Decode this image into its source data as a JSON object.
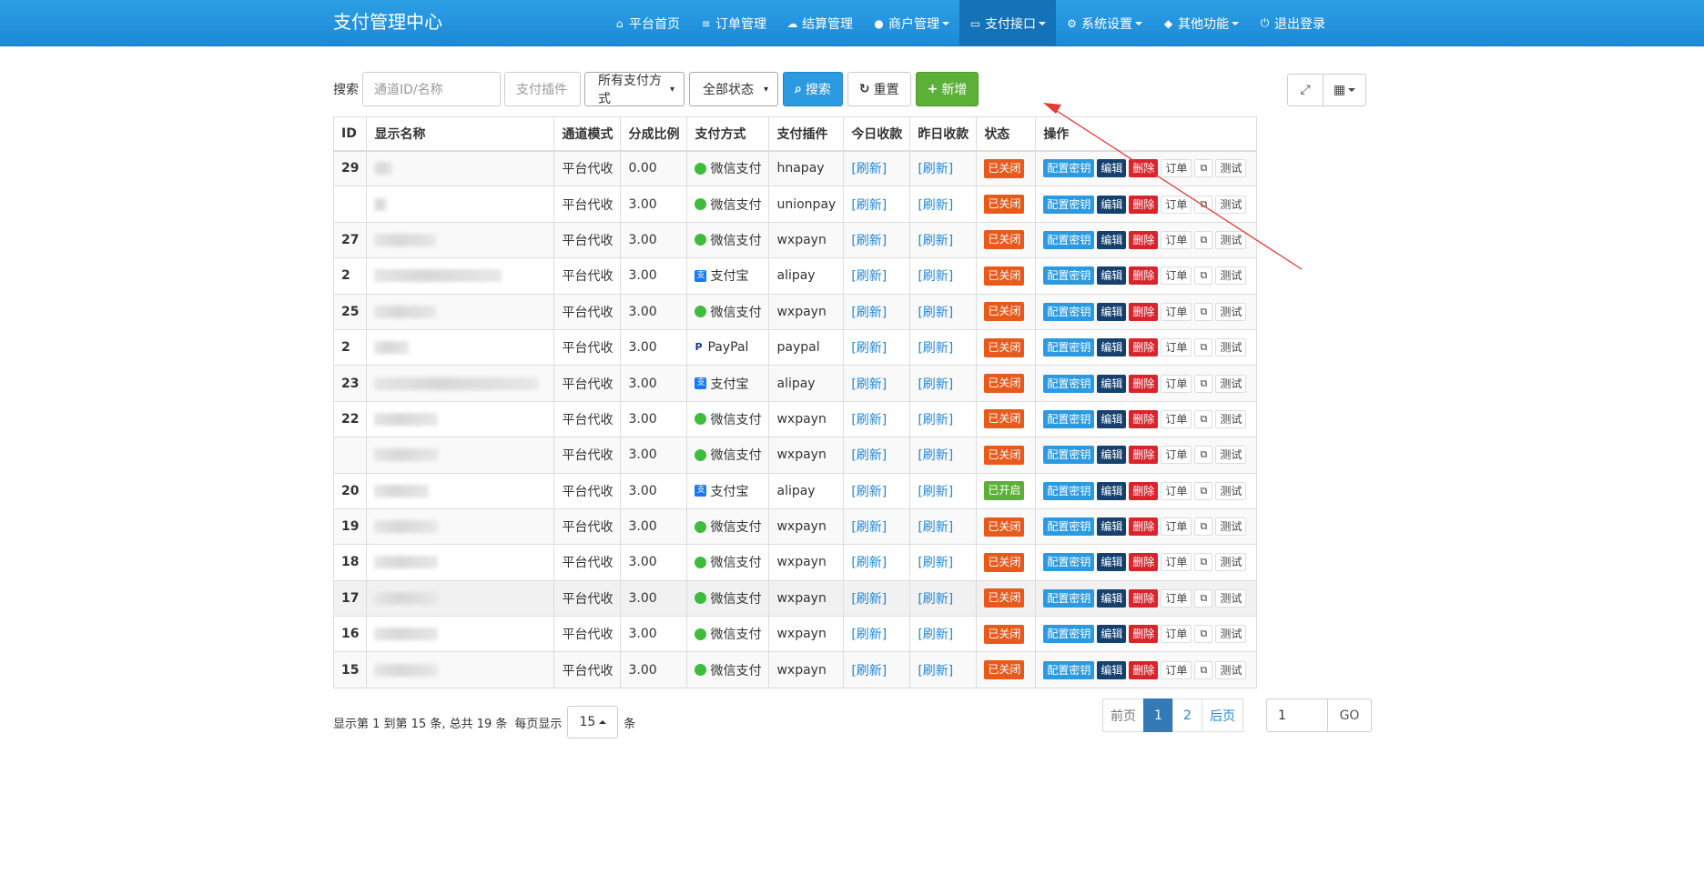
{
  "brand": "支付管理中心",
  "nav": [
    {
      "icon": "home-icon",
      "glyph": "⌂",
      "label": "平台首页",
      "caret": false,
      "active": false
    },
    {
      "icon": "list-icon",
      "glyph": "≡",
      "label": "订单管理",
      "caret": false,
      "active": false
    },
    {
      "icon": "cloud-icon",
      "glyph": "☁",
      "label": "结算管理",
      "caret": false,
      "active": false
    },
    {
      "icon": "user-icon",
      "glyph": "●",
      "label": "商户管理",
      "caret": true,
      "active": false
    },
    {
      "icon": "card-icon",
      "glyph": "▭",
      "label": "支付接口",
      "caret": true,
      "active": true
    },
    {
      "icon": "gear-icon",
      "glyph": "⚙",
      "label": "系统设置",
      "caret": true,
      "active": false
    },
    {
      "icon": "cube-icon",
      "glyph": "◆",
      "label": "其他功能",
      "caret": true,
      "active": false
    },
    {
      "icon": "power-icon",
      "glyph": "⏻",
      "label": "退出登录",
      "caret": false,
      "active": false
    }
  ],
  "toolbar": {
    "search_label": "搜索",
    "channel_placeholder": "通道ID/名称",
    "plugin_placeholder": "支付插件",
    "method_select": "所有支付方式",
    "status_select": "全部状态",
    "search_button": "搜索",
    "reset_button": "重置",
    "add_button": "新增"
  },
  "table": {
    "headers": [
      "ID",
      "显示名称",
      "通道模式",
      "分成比例",
      "支付方式",
      "支付插件",
      "今日收款",
      "昨日收款",
      "状态",
      "操作"
    ],
    "actions": {
      "config": "配置密钥",
      "edit": "编辑",
      "delete": "删除",
      "orders": "订单",
      "copy": "⧉",
      "test": "测试"
    },
    "rows": [
      {
        "id": "29",
        "mode": "平台代收",
        "rate": "0.00",
        "method": "微信支付",
        "method_type": "wx",
        "plugin": "hnapay",
        "today": "[刷新]",
        "yesterday": "[刷新]",
        "status": "已关闭",
        "on": false
      },
      {
        "id": "",
        "mode": "平台代收",
        "rate": "3.00",
        "method": "微信支付",
        "method_type": "wx",
        "plugin": "unionpay",
        "today": "[刷新]",
        "yesterday": "[刷新]",
        "status": "已关闭",
        "on": false
      },
      {
        "id": "27",
        "mode": "平台代收",
        "rate": "3.00",
        "method": "微信支付",
        "method_type": "wx",
        "plugin": "wxpayn",
        "today": "[刷新]",
        "yesterday": "[刷新]",
        "status": "已关闭",
        "on": false
      },
      {
        "id": "2",
        "mode": "平台代收",
        "rate": "3.00",
        "method": "支付宝",
        "method_type": "ali",
        "plugin": "alipay",
        "today": "[刷新]",
        "yesterday": "[刷新]",
        "status": "已关闭",
        "on": false
      },
      {
        "id": "25",
        "mode": "平台代收",
        "rate": "3.00",
        "method": "微信支付",
        "method_type": "wx",
        "plugin": "wxpayn",
        "today": "[刷新]",
        "yesterday": "[刷新]",
        "status": "已关闭",
        "on": false
      },
      {
        "id": "2",
        "mode": "平台代收",
        "rate": "3.00",
        "method": "PayPal",
        "method_type": "pp",
        "plugin": "paypal",
        "today": "[刷新]",
        "yesterday": "[刷新]",
        "status": "已关闭",
        "on": false
      },
      {
        "id": "23",
        "mode": "平台代收",
        "rate": "3.00",
        "method": "支付宝",
        "method_type": "ali",
        "plugin": "alipay",
        "today": "[刷新]",
        "yesterday": "[刷新]",
        "status": "已关闭",
        "on": false
      },
      {
        "id": "22",
        "mode": "平台代收",
        "rate": "3.00",
        "method": "微信支付",
        "method_type": "wx",
        "plugin": "wxpayn",
        "today": "[刷新]",
        "yesterday": "[刷新]",
        "status": "已关闭",
        "on": false
      },
      {
        "id": "",
        "mode": "平台代收",
        "rate": "3.00",
        "method": "微信支付",
        "method_type": "wx",
        "plugin": "wxpayn",
        "today": "[刷新]",
        "yesterday": "[刷新]",
        "status": "已关闭",
        "on": false
      },
      {
        "id": "20",
        "mode": "平台代收",
        "rate": "3.00",
        "method": "支付宝",
        "method_type": "ali",
        "plugin": "alipay",
        "today": "[刷新]",
        "yesterday": "[刷新]",
        "status": "已开启",
        "on": true
      },
      {
        "id": "19",
        "mode": "平台代收",
        "rate": "3.00",
        "method": "微信支付",
        "method_type": "wx",
        "plugin": "wxpayn",
        "today": "[刷新]",
        "yesterday": "[刷新]",
        "status": "已关闭",
        "on": false
      },
      {
        "id": "18",
        "mode": "平台代收",
        "rate": "3.00",
        "method": "微信支付",
        "method_type": "wx",
        "plugin": "wxpayn",
        "today": "[刷新]",
        "yesterday": "[刷新]",
        "status": "已关闭",
        "on": false
      },
      {
        "id": "17",
        "mode": "平台代收",
        "rate": "3.00",
        "method": "微信支付",
        "method_type": "wx",
        "plugin": "wxpayn",
        "today": "[刷新]",
        "yesterday": "[刷新]",
        "status": "已关闭",
        "on": false
      },
      {
        "id": "16",
        "mode": "平台代收",
        "rate": "3.00",
        "method": "微信支付",
        "method_type": "wx",
        "plugin": "wxpayn",
        "today": "[刷新]",
        "yesterday": "[刷新]",
        "status": "已关闭",
        "on": false
      },
      {
        "id": "15",
        "mode": "平台代收",
        "rate": "3.00",
        "method": "微信支付",
        "method_type": "wx",
        "plugin": "wxpayn",
        "today": "[刷新]",
        "yesterday": "[刷新]",
        "status": "已关闭",
        "on": false
      }
    ]
  },
  "footer": {
    "info": "显示第 1 到第 15 条, 总共 19 条",
    "per_page_label": "每页显示",
    "per_page_value": "15",
    "per_page_unit": "条",
    "prev": "前页",
    "pages": [
      "1",
      "2"
    ],
    "current_page": "1",
    "next": "后页",
    "goto_value": "1",
    "goto_button": "GO"
  },
  "colors": {
    "navbar": "#1b8ad8",
    "status_off": "#e8591c",
    "status_on": "#5cb038",
    "annotation_arrow": "#e53935"
  }
}
